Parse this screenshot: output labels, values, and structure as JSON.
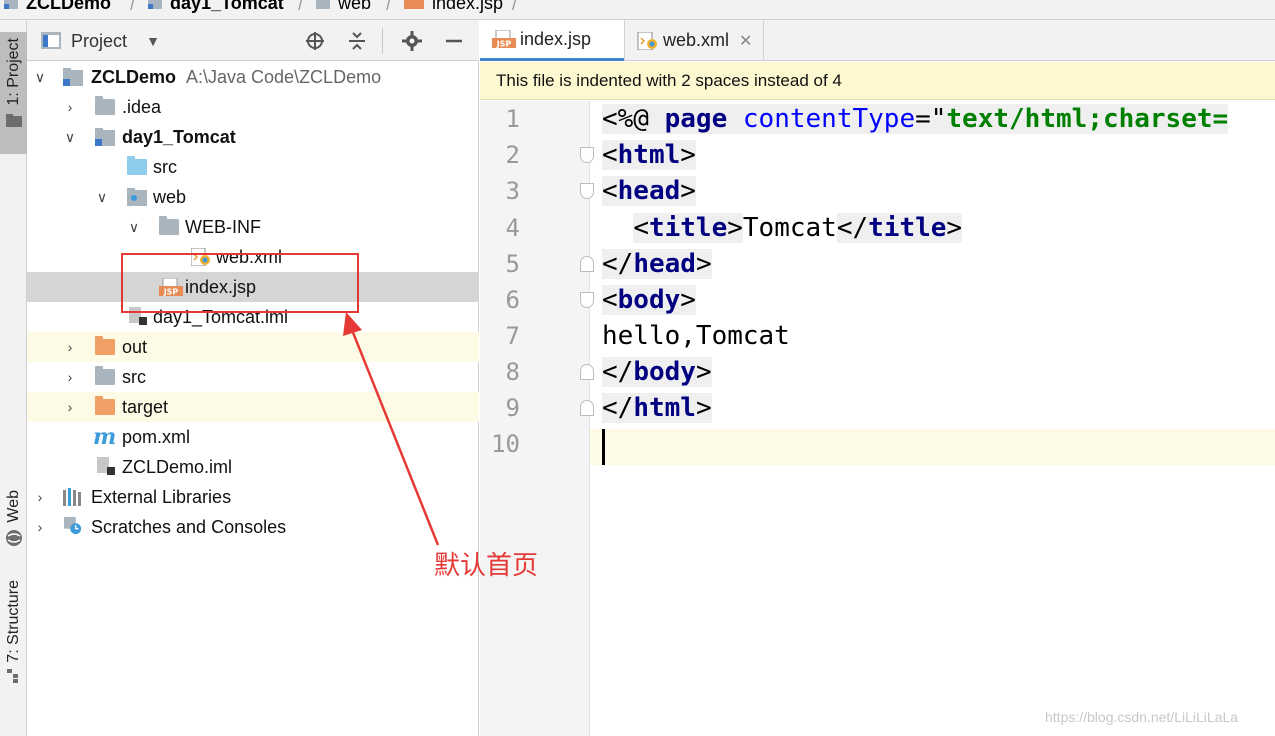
{
  "breadcrumb": {
    "items": [
      "ZCLDemo",
      "day1_Tomcat",
      "web",
      "index.jsp"
    ]
  },
  "left_strip": {
    "project_tab": "1: Project",
    "web_tab": "Web",
    "structure_tab": "7: Structure"
  },
  "project_panel": {
    "title": "Project",
    "tree": [
      {
        "label": "ZCLDemo",
        "path": "A:\\Java Code\\ZCLDemo"
      },
      {
        "label": ".idea"
      },
      {
        "label": "day1_Tomcat"
      },
      {
        "label": "src"
      },
      {
        "label": "web"
      },
      {
        "label": "WEB-INF"
      },
      {
        "label": "web.xml"
      },
      {
        "label": "index.jsp"
      },
      {
        "label": "day1_Tomcat.iml"
      },
      {
        "label": "out"
      },
      {
        "label": "src"
      },
      {
        "label": "target"
      },
      {
        "label": "pom.xml"
      },
      {
        "label": "ZCLDemo.iml"
      },
      {
        "label": "External Libraries"
      },
      {
        "label": "Scratches and Consoles"
      }
    ]
  },
  "editor": {
    "tabs": [
      {
        "label": "index.jsp"
      },
      {
        "label": "web.xml"
      }
    ],
    "notice": "This file is indented with 2 spaces instead of 4",
    "line_numbers": [
      "1",
      "2",
      "3",
      "4",
      "5",
      "6",
      "7",
      "8",
      "9",
      "10"
    ],
    "code": {
      "l1_open": "<%@ ",
      "l1_page": "page",
      "l1_sp": " ",
      "l1_attr": "contentType",
      "l1_eq": "=\"",
      "l1_val": "text/html;charset=",
      "l2_lt": "<",
      "l2_tag": "html",
      "l2_gt": ">",
      "l3_lt": "<",
      "l3_tag": "head",
      "l3_gt": ">",
      "l4_indent": "  ",
      "l4_lt": "<",
      "l4_tag": "title",
      "l4_gt": ">",
      "l4_text": "Tomcat",
      "l4_lt2": "</",
      "l4_tag2": "title",
      "l4_gt2": ">",
      "l5_lt": "</",
      "l5_tag": "head",
      "l5_gt": ">",
      "l6_lt": "<",
      "l6_tag": "body",
      "l6_gt": ">",
      "l7_text": "hello,Tomcat",
      "l8_lt": "</",
      "l8_tag": "body",
      "l8_gt": ">",
      "l9_lt": "</",
      "l9_tag": "html",
      "l9_gt": ">"
    }
  },
  "annotation": {
    "text": "默认首页",
    "color": "#e53935"
  },
  "watermark": "https://blog.csdn.net/LiLiLiLaLa",
  "colors": {
    "accent": "#4083c9",
    "notice_bg": "#fdf8d0",
    "selection": "#d5d5d5"
  }
}
